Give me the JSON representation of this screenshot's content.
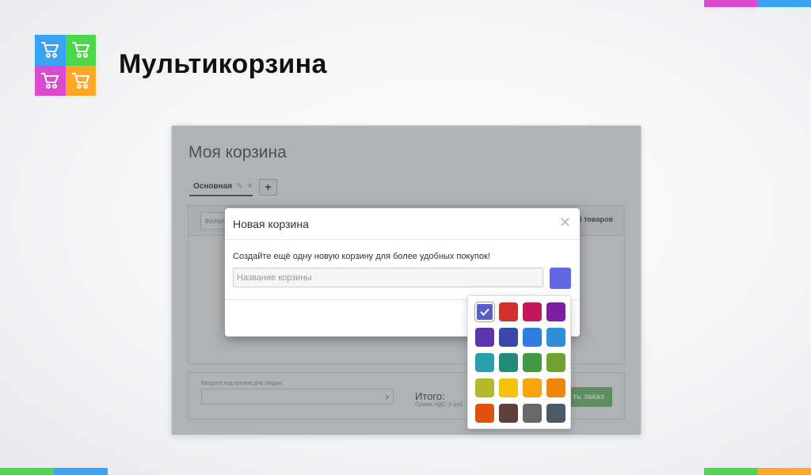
{
  "brand": {
    "title": "Мультикорзина"
  },
  "app": {
    "title": "Моя корзина",
    "tab_label": "Основная",
    "add_tab_label": "+",
    "filter_placeholder": "Фильтр",
    "items_count": "0 товаров",
    "coupon_label": "Введите код купона для скидки:",
    "total_label": "Итого:",
    "vat_label": "Сумма НДС: 0 руб.",
    "checkout_label": "ть заказ"
  },
  "modal": {
    "title": "Новая корзина",
    "description": "Создайте ещё одну новую корзину для более удобных покупок!",
    "name_placeholder": "Название корзины",
    "selected_color": "#6368e0"
  },
  "colors": {
    "logo": [
      "#3aa4f4",
      "#4cd84a",
      "#d94bd0",
      "#ffa726"
    ],
    "palette": [
      "#5a5fc8",
      "#d32f2f",
      "#c2185b",
      "#7b1fa2",
      "#5e35b1",
      "#3949ab",
      "#2f7de1",
      "#2e8fd8",
      "#2a9fb0",
      "#238a78",
      "#449a44",
      "#72a332",
      "#b5b82a",
      "#f5c10a",
      "#f7a50c",
      "#f2850c",
      "#e0510c",
      "#5d4037",
      "#686868",
      "#4a5a66"
    ],
    "selected_index": 0
  }
}
